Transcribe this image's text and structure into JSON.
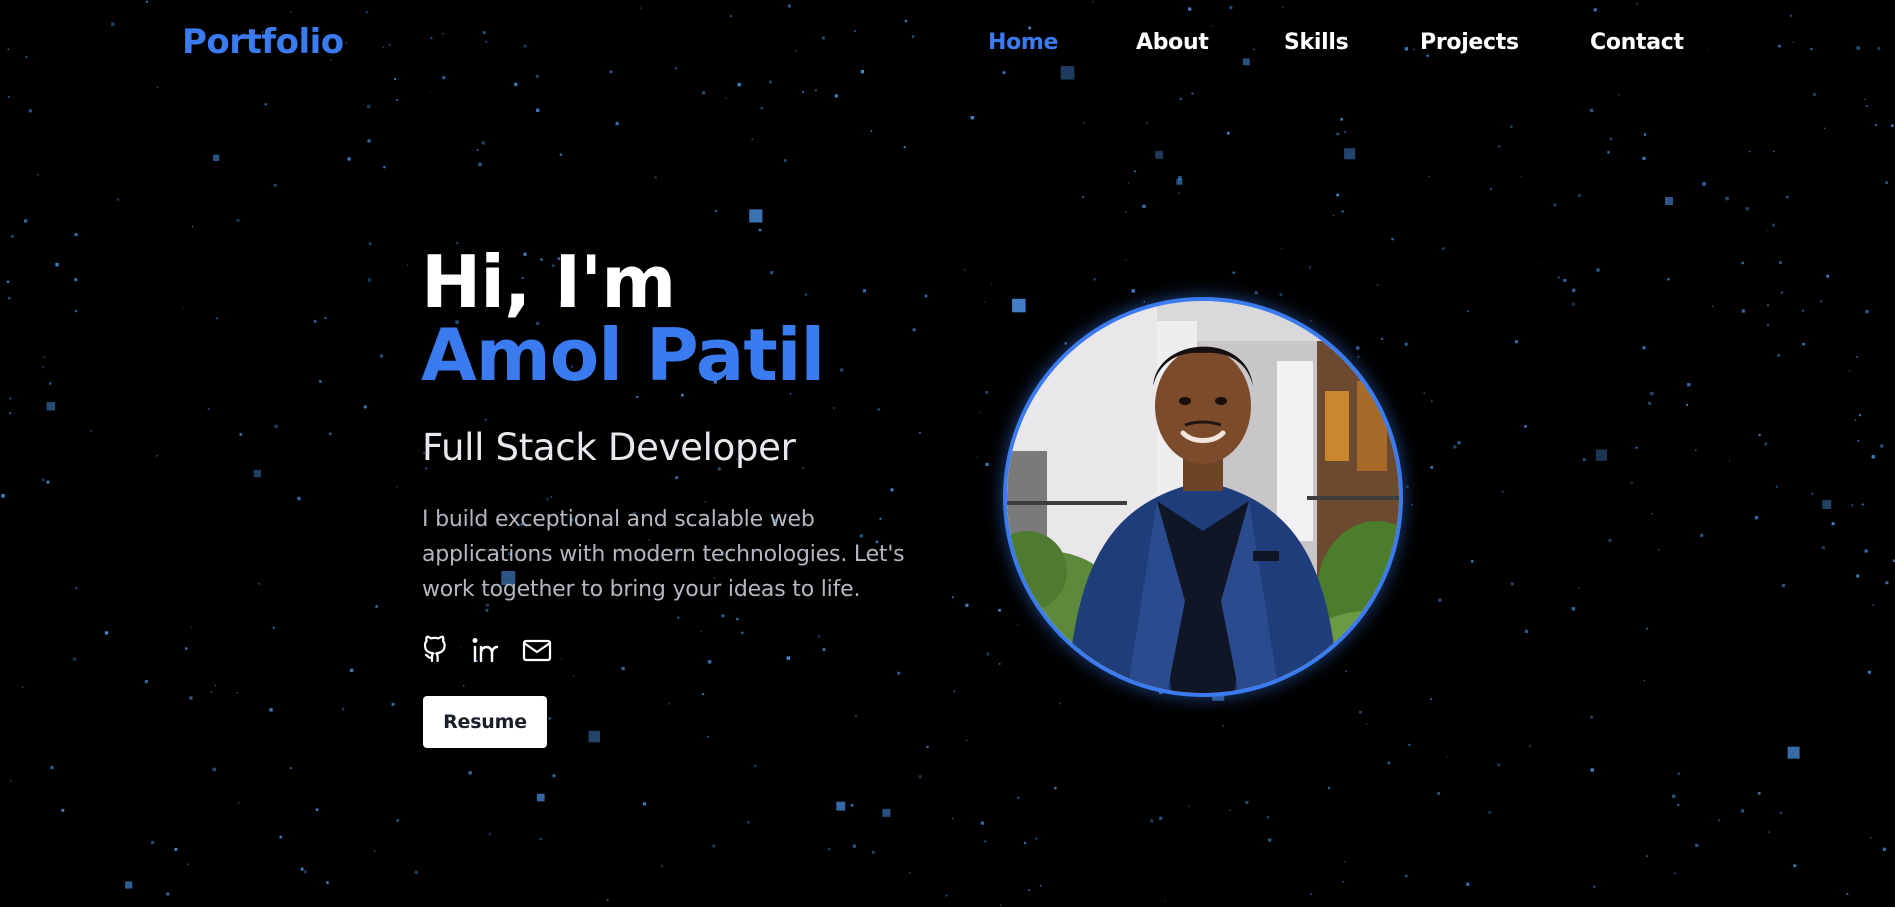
{
  "brand": {
    "logo": "Portfolio"
  },
  "nav": {
    "items": [
      {
        "label": "Home",
        "active": true
      },
      {
        "label": "About",
        "active": false
      },
      {
        "label": "Skills",
        "active": false
      },
      {
        "label": "Projects",
        "active": false
      },
      {
        "label": "Contact",
        "active": false
      }
    ]
  },
  "hero": {
    "greeting": "Hi, I'm",
    "name": "Amol Patil",
    "role": "Full Stack Developer",
    "description": "I build exceptional and scalable web applications with modern technologies. Let's work together to bring your ideas to life.",
    "resume_label": "Resume"
  },
  "socials": [
    {
      "icon": "github-icon"
    },
    {
      "icon": "linkedin-icon"
    },
    {
      "icon": "mail-icon"
    }
  ],
  "profile_image": {
    "icon": "profile-photo"
  },
  "colors": {
    "background": "#000000",
    "accent": "#3b7bf0",
    "text": "#ffffff",
    "muted": "#b4b7c0",
    "star": "#4a8fe0"
  }
}
